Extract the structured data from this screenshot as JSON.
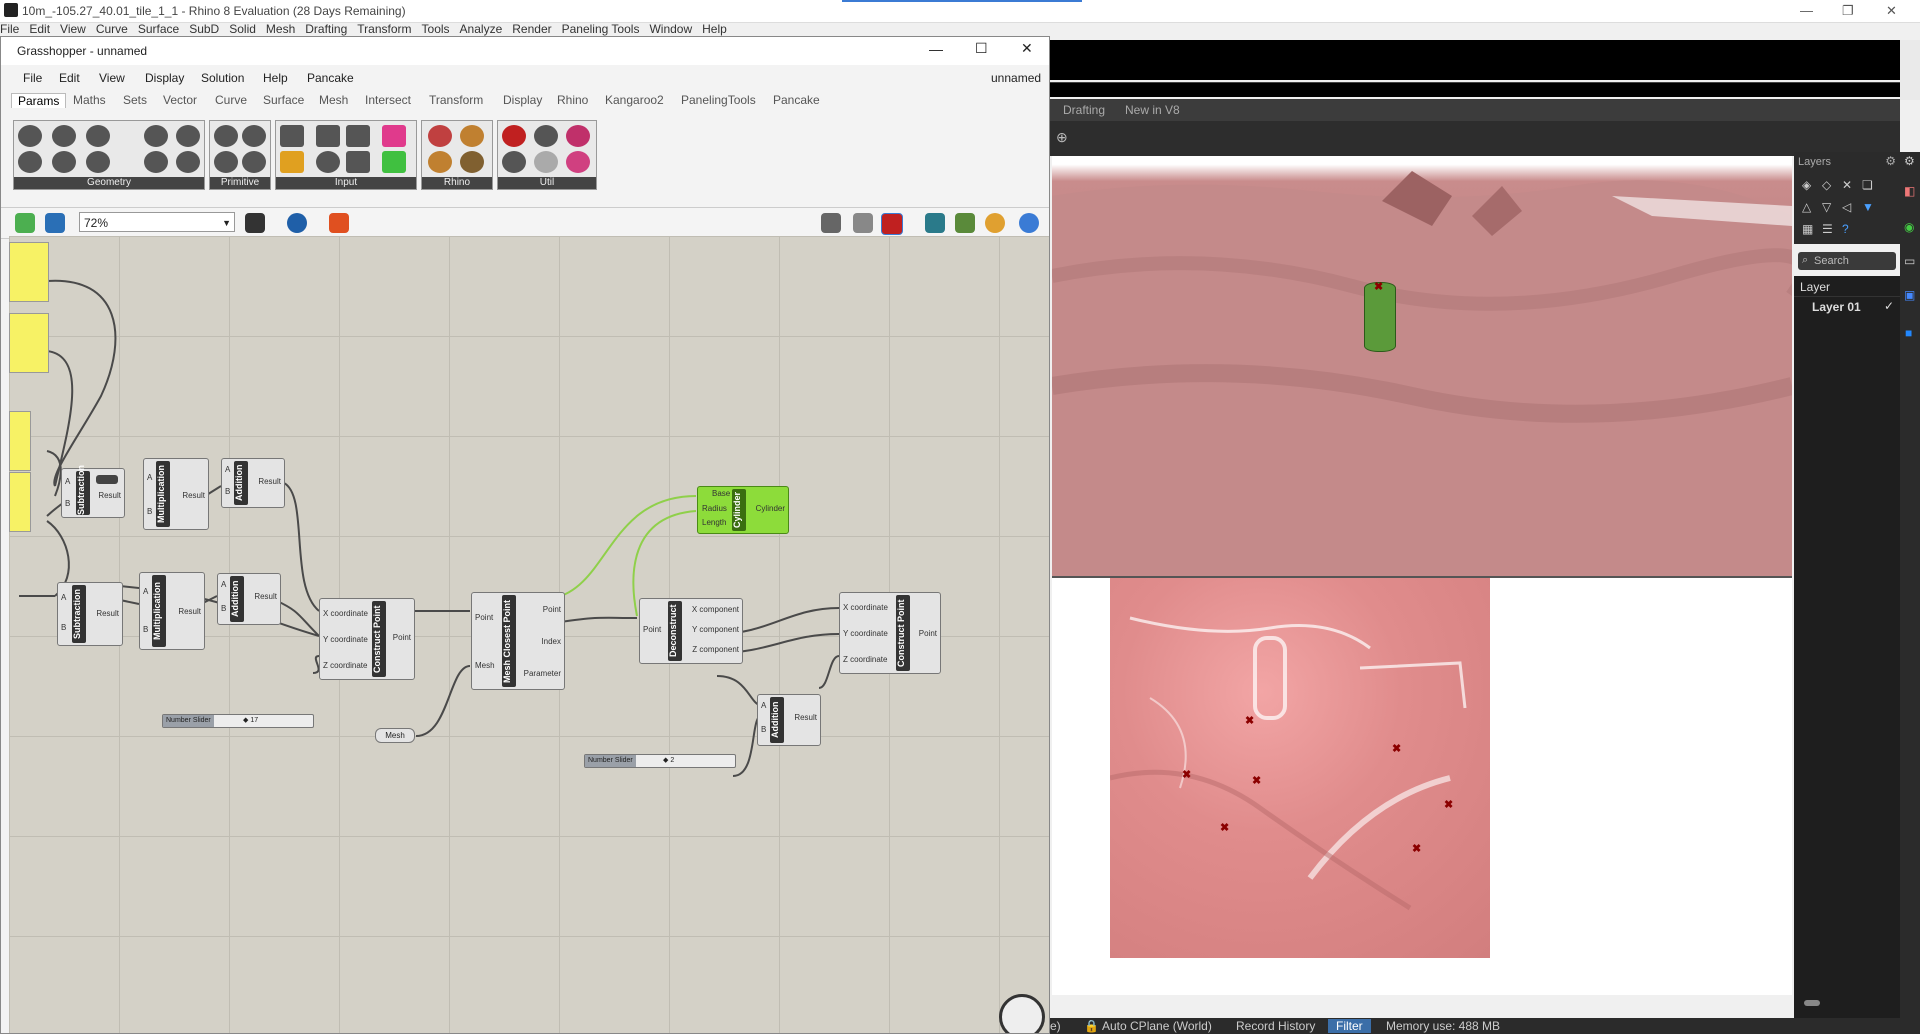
{
  "rhino": {
    "window_title": "10m_-105.27_40.01_tile_1_1 - Rhino 8 Evaluation (28 Days Remaining)",
    "menu": [
      "File",
      "Edit",
      "View",
      "Curve",
      "Surface",
      "SubD",
      "Solid",
      "Mesh",
      "Drafting",
      "Transform",
      "Tools",
      "Analyze",
      "Render",
      "Paneling Tools",
      "Window",
      "Help"
    ],
    "tabs": [
      "Drafting",
      "New in V8"
    ],
    "layers_title": "Layers",
    "search_placeholder": "Search",
    "layer_header": "Layer",
    "layer_item": "Layer 01",
    "status": {
      "e": "e)",
      "cplane": "Auto CPlane (World)",
      "record": "Record History",
      "filter": "Filter",
      "memory": "Memory use: 488 MB"
    }
  },
  "gh": {
    "title": "Grasshopper - unnamed",
    "doc_name": "unnamed",
    "menu": [
      "File",
      "Edit",
      "View",
      "Display",
      "Solution",
      "Help",
      "Pancake"
    ],
    "tabs": [
      "Params",
      "Maths",
      "Sets",
      "Vector",
      "Curve",
      "Surface",
      "Mesh",
      "Intersect",
      "Transform",
      "Display",
      "Rhino",
      "Kangaroo2",
      "PanelingTools",
      "Pancake"
    ],
    "groups": [
      "Geometry",
      "Primitive",
      "Input",
      "Rhino",
      "Util"
    ],
    "zoom": "72%",
    "components": {
      "sub1": {
        "name": "Subtraction",
        "a": "A",
        "b": "B",
        "out": "Result"
      },
      "mul1": {
        "name": "Multiplication",
        "a": "A",
        "b": "B",
        "out": "Result"
      },
      "add1": {
        "name": "Addition",
        "a": "A",
        "b": "B",
        "out": "Result"
      },
      "sub2": {
        "name": "Subtraction",
        "a": "A",
        "b": "B",
        "out": "Result"
      },
      "mul2": {
        "name": "Multiplication",
        "a": "A",
        "b": "B",
        "out": "Result"
      },
      "add2": {
        "name": "Addition",
        "a": "A",
        "b": "B",
        "out": "Result"
      },
      "cp1": {
        "name": "Construct Point",
        "x": "X coordinate",
        "y": "Y coordinate",
        "z": "Z coordinate",
        "out": "Point"
      },
      "mcp": {
        "name": "Mesh Closest Point",
        "in1": "Point",
        "in2": "Mesh",
        "o1": "Point",
        "o2": "Index",
        "o3": "Parameter"
      },
      "cyl": {
        "name": "Cylinder",
        "i1": "Base",
        "i2": "Radius",
        "i3": "Length",
        "out": "Cylinder"
      },
      "dec": {
        "name": "Deconstruct",
        "in": "Point",
        "o1": "X component",
        "o2": "Y component",
        "o3": "Z component"
      },
      "cp2": {
        "name": "Construct Point",
        "x": "X coordinate",
        "y": "Y coordinate",
        "z": "Z coordinate",
        "out": "Point"
      },
      "add3": {
        "name": "Addition",
        "a": "A",
        "b": "B",
        "out": "Result"
      },
      "mesh_param": "Mesh",
      "slider1": {
        "name": "Number Slider",
        "value": "◆ 17"
      },
      "slider2": {
        "name": "Number Slider",
        "value": "◆ 2"
      }
    }
  }
}
